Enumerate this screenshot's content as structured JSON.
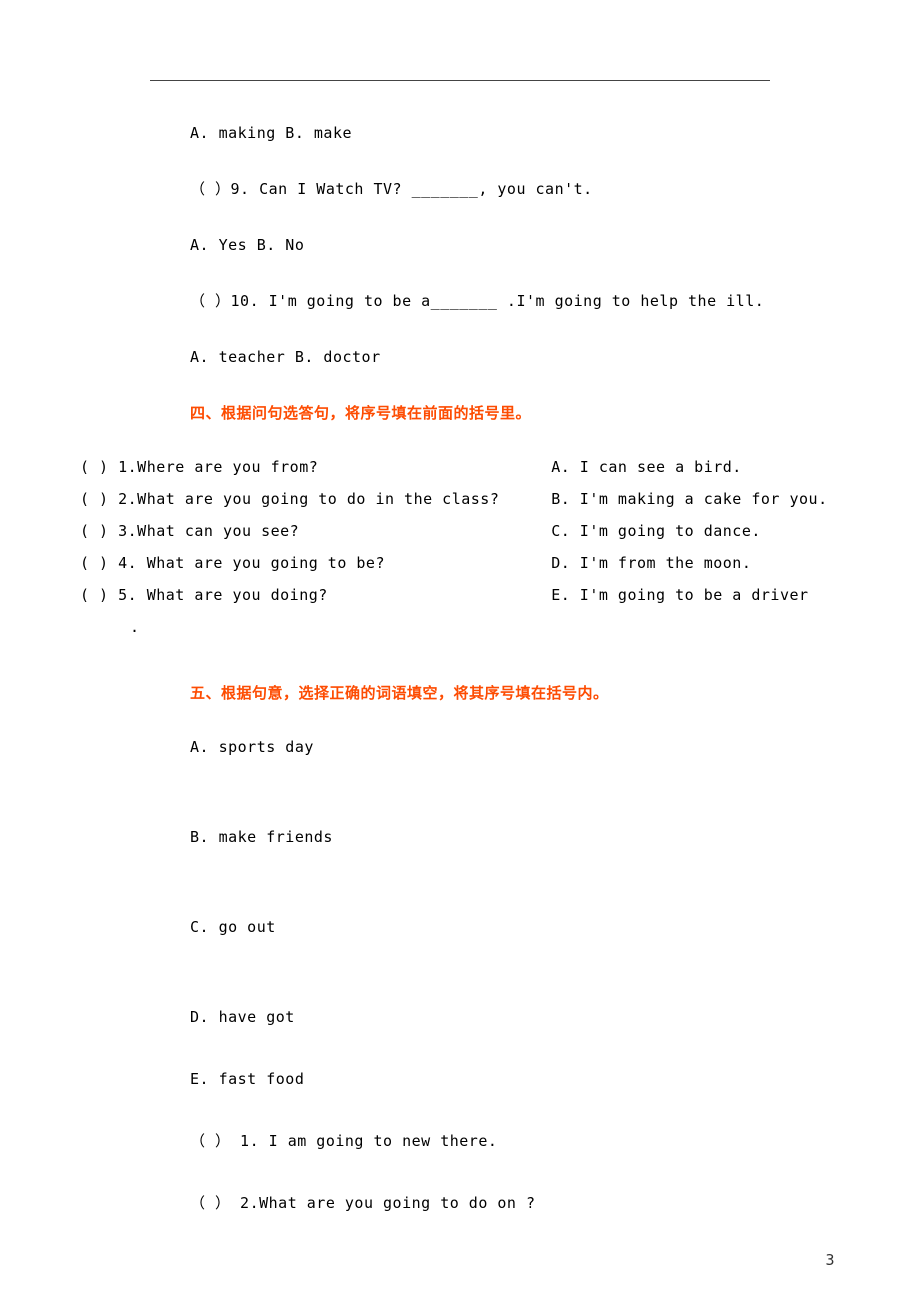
{
  "q8": {
    "opts": "A. making    B. make"
  },
  "q9": {
    "text": "（ ）9. Can I Watch TV? _______, you can't.",
    "opts": "A. Yes    B. No"
  },
  "q10": {
    "text": "（ ）10. I'm going to be a_______ .I'm going to help the ill.",
    "opts": "A. teacher    B. doctor"
  },
  "section4": {
    "heading": "四、根据问句选答句，将序号填在前面的括号里。",
    "rows": [
      {
        "q": "(  )  1.Where are you from?",
        "a": "A. I can see a bird."
      },
      {
        "q": "(  )  2.What are you going to do in the class?",
        "a": "B. I'm making a cake for you."
      },
      {
        "q": "(  )  3.What can you see?",
        "a": "C. I'm going to dance."
      },
      {
        "q": "(  )  4. What are you going to be?",
        "a": "D. I'm from the moon."
      },
      {
        "q": "(  )  5. What are you doing?",
        "a": "E. I'm going to be a driver"
      }
    ],
    "trailing_dot": "."
  },
  "section5": {
    "heading": "五、根据句意，选择正确的词语填空，将其序号填在括号内。",
    "options": [
      "A. sports day",
      "B. make friends",
      "C. go out",
      "D. have got",
      "E. fast food"
    ],
    "items": [
      "（  ）  1. I am going to new there.",
      "（  ）  2.What are you going to do on ?"
    ]
  },
  "page_number": "3"
}
